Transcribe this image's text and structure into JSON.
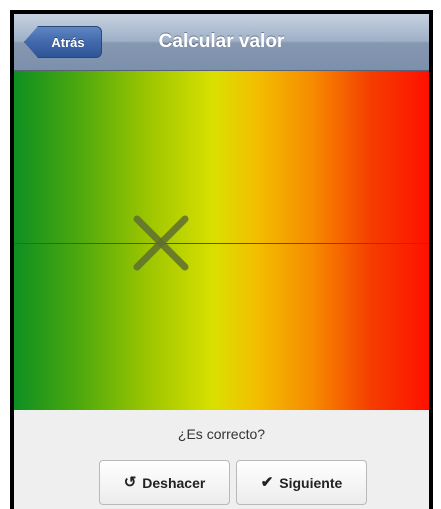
{
  "nav": {
    "back_label": "Atrás",
    "title": "Calcular valor"
  },
  "question": "¿Es correcto?",
  "buttons": {
    "undo_label": "Deshacer",
    "undo_icon": "undo-icon",
    "next_label": "Siguiente",
    "next_icon": "checkmark-icon"
  },
  "marker": {
    "icon": "x-marker-icon",
    "color": "#5f6f2f"
  },
  "colors": {
    "gradient_start": "#0e8f22",
    "gradient_mid": "#d9e000",
    "gradient_end": "#ff1000",
    "nav_bar": "#9fb0c7",
    "back_button": "#3f67a9"
  }
}
